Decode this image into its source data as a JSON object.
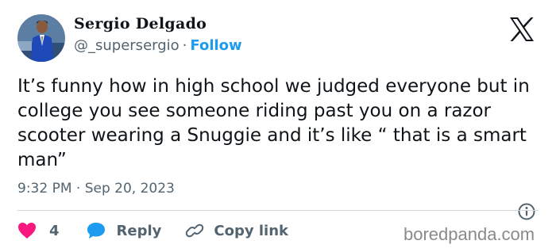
{
  "author": {
    "display_name": "Sergio Delgado",
    "handle": "@_supersergio",
    "separator": "·",
    "follow_label": "Follow"
  },
  "tweet": {
    "text": "It’s funny how in high school we judged everyone but in college you see someone riding past you on a razor scooter wearing a Snuggie and it’s like “ that is a smart man”",
    "timestamp": "9:32 PM · Sep 20, 2023"
  },
  "actions": {
    "like_count": "4",
    "reply_label": "Reply",
    "copy_link_label": "Copy link"
  },
  "watermark": "boredpanda.com",
  "colors": {
    "accent": "#1d9bf0",
    "like": "#f91880",
    "secondary_text": "#536471",
    "primary_text": "#0f1419"
  },
  "icons": [
    "x-logo-icon",
    "info-icon",
    "heart-icon",
    "reply-bubble-icon",
    "link-icon"
  ]
}
